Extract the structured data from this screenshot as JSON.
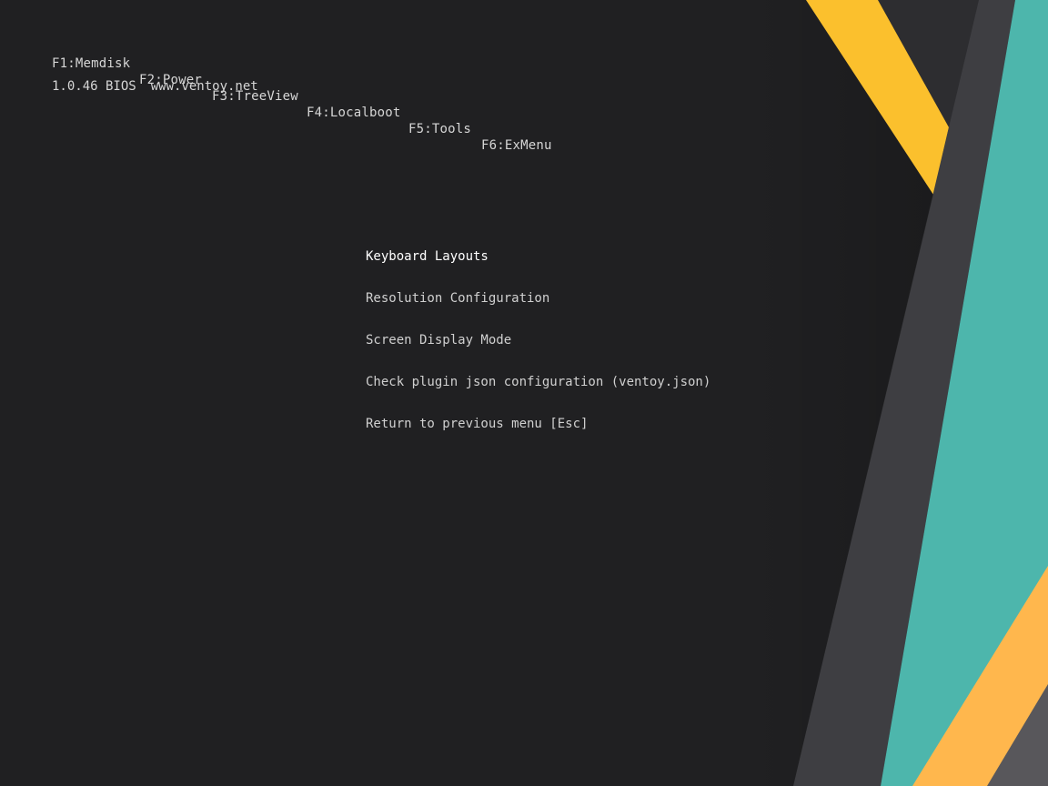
{
  "hotkeys": [
    {
      "label": "F1:Memdisk"
    },
    {
      "label": "F2:Power"
    },
    {
      "label": "F3:TreeView"
    },
    {
      "label": "F4:Localboot"
    },
    {
      "label": "F5:Tools"
    },
    {
      "label": "F6:ExMenu"
    }
  ],
  "status": {
    "version": "1.0.46 BIOS",
    "website": "www.ventoy.net"
  },
  "menu": {
    "selected_index": 0,
    "items": [
      {
        "label": "Keyboard Layouts"
      },
      {
        "label": "Resolution Configuration"
      },
      {
        "label": "Screen Display Mode"
      },
      {
        "label": "Check plugin json configuration (ventoy.json)"
      },
      {
        "label": "Return to previous menu [Esc]"
      }
    ]
  },
  "theme": {
    "background": "#202022",
    "accent_yellow": "#fbc02d",
    "accent_orange": "#ffb74d",
    "accent_teal": "#4db6ac",
    "stripe_gray": "#3e3e42"
  }
}
